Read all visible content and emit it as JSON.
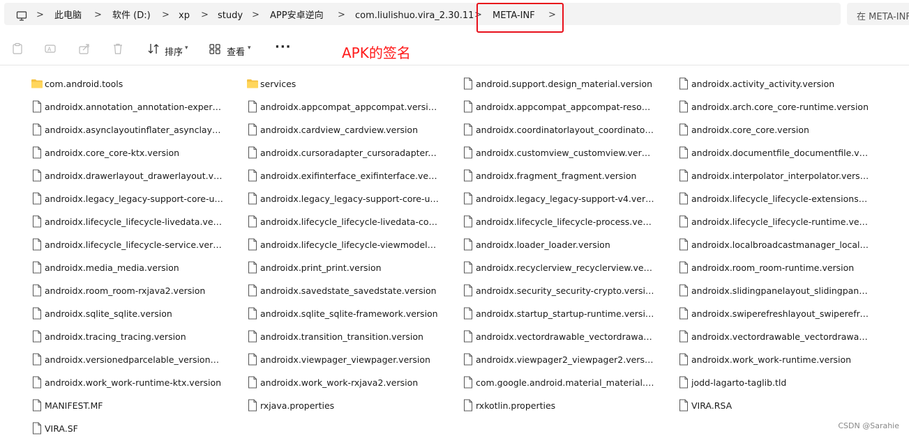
{
  "breadcrumb": {
    "items": [
      "此电脑",
      "软件 (D:)",
      "xp",
      "study",
      "APP安卓逆向",
      "com.liulishuo.vira_2.30.11",
      "META-INF"
    ],
    "separator": ">"
  },
  "search": {
    "placeholder": "在 META-INF"
  },
  "toolbar": {
    "sort_label": "排序",
    "view_label": "查看",
    "more_label": "···"
  },
  "annotation": {
    "text": "APK的签名",
    "color": "#ff1a1a"
  },
  "files": [
    {
      "name": "com.android.tools",
      "type": "folder"
    },
    {
      "name": "services",
      "type": "folder"
    },
    {
      "name": "android.support.design_material.version",
      "type": "file"
    },
    {
      "name": "androidx.activity_activity.version",
      "type": "file"
    },
    {
      "name": "androidx.annotation_annotation-experime...",
      "type": "file"
    },
    {
      "name": "androidx.appcompat_appcompat.version",
      "type": "file"
    },
    {
      "name": "androidx.appcompat_appcompat-resourc...",
      "type": "file"
    },
    {
      "name": "androidx.arch.core_core-runtime.version",
      "type": "file"
    },
    {
      "name": "androidx.asynclayoutinflater_asynclayouti...",
      "type": "file"
    },
    {
      "name": "androidx.cardview_cardview.version",
      "type": "file"
    },
    {
      "name": "androidx.coordinatorlayout_coordinatorla...",
      "type": "file"
    },
    {
      "name": "androidx.core_core.version",
      "type": "file"
    },
    {
      "name": "androidx.core_core-ktx.version",
      "type": "file"
    },
    {
      "name": "androidx.cursoradapter_cursoradapter.ve...",
      "type": "file"
    },
    {
      "name": "androidx.customview_customview.version",
      "type": "file"
    },
    {
      "name": "androidx.documentfile_documentfile.versi...",
      "type": "file"
    },
    {
      "name": "androidx.drawerlayout_drawerlayout.versi...",
      "type": "file"
    },
    {
      "name": "androidx.exifinterface_exifinterface.version",
      "type": "file"
    },
    {
      "name": "androidx.fragment_fragment.version",
      "type": "file"
    },
    {
      "name": "androidx.interpolator_interpolator.version",
      "type": "file"
    },
    {
      "name": "androidx.legacy_legacy-support-core-ui.v...",
      "type": "file"
    },
    {
      "name": "androidx.legacy_legacy-support-core-util...",
      "type": "file"
    },
    {
      "name": "androidx.legacy_legacy-support-v4.version",
      "type": "file"
    },
    {
      "name": "androidx.lifecycle_lifecycle-extensions.vers...",
      "type": "file"
    },
    {
      "name": "androidx.lifecycle_lifecycle-livedata.version",
      "type": "file"
    },
    {
      "name": "androidx.lifecycle_lifecycle-livedata-core.v...",
      "type": "file"
    },
    {
      "name": "androidx.lifecycle_lifecycle-process.version",
      "type": "file"
    },
    {
      "name": "androidx.lifecycle_lifecycle-runtime.version",
      "type": "file"
    },
    {
      "name": "androidx.lifecycle_lifecycle-service.version",
      "type": "file"
    },
    {
      "name": "androidx.lifecycle_lifecycle-viewmodel.ver...",
      "type": "file"
    },
    {
      "name": "androidx.loader_loader.version",
      "type": "file"
    },
    {
      "name": "androidx.localbroadcastmanager_localbr...",
      "type": "file"
    },
    {
      "name": "androidx.media_media.version",
      "type": "file"
    },
    {
      "name": "androidx.print_print.version",
      "type": "file"
    },
    {
      "name": "androidx.recyclerview_recyclerview.version",
      "type": "file"
    },
    {
      "name": "androidx.room_room-runtime.version",
      "type": "file"
    },
    {
      "name": "androidx.room_room-rxjava2.version",
      "type": "file"
    },
    {
      "name": "androidx.savedstate_savedstate.version",
      "type": "file"
    },
    {
      "name": "androidx.security_security-crypto.version",
      "type": "file"
    },
    {
      "name": "androidx.slidingpanelayout_slidingpanela...",
      "type": "file"
    },
    {
      "name": "androidx.sqlite_sqlite.version",
      "type": "file"
    },
    {
      "name": "androidx.sqlite_sqlite-framework.version",
      "type": "file"
    },
    {
      "name": "androidx.startup_startup-runtime.version",
      "type": "file"
    },
    {
      "name": "androidx.swiperefreshlayout_swiperefresh...",
      "type": "file"
    },
    {
      "name": "androidx.tracing_tracing.version",
      "type": "file"
    },
    {
      "name": "androidx.transition_transition.version",
      "type": "file"
    },
    {
      "name": "androidx.vectordrawable_vectordrawable....",
      "type": "file"
    },
    {
      "name": "androidx.vectordrawable_vectordrawable...",
      "type": "file"
    },
    {
      "name": "androidx.versionedparcelable_versionedp...",
      "type": "file"
    },
    {
      "name": "androidx.viewpager_viewpager.version",
      "type": "file"
    },
    {
      "name": "androidx.viewpager2_viewpager2.version",
      "type": "file"
    },
    {
      "name": "androidx.work_work-runtime.version",
      "type": "file"
    },
    {
      "name": "androidx.work_work-runtime-ktx.version",
      "type": "file"
    },
    {
      "name": "androidx.work_work-rxjava2.version",
      "type": "file"
    },
    {
      "name": "com.google.android.material_material.ver...",
      "type": "file"
    },
    {
      "name": "jodd-lagarto-taglib.tld",
      "type": "file"
    },
    {
      "name": "MANIFEST.MF",
      "type": "file"
    },
    {
      "name": "rxjava.properties",
      "type": "file"
    },
    {
      "name": "rxkotlin.properties",
      "type": "file"
    },
    {
      "name": "VIRA.RSA",
      "type": "file"
    },
    {
      "name": "VIRA.SF",
      "type": "file"
    }
  ],
  "watermark": "CSDN @Sarahie",
  "colors": {
    "highlight": "#e8101b",
    "folder": "#f5c243",
    "breadcrumb_bg": "#f3f3f3"
  }
}
